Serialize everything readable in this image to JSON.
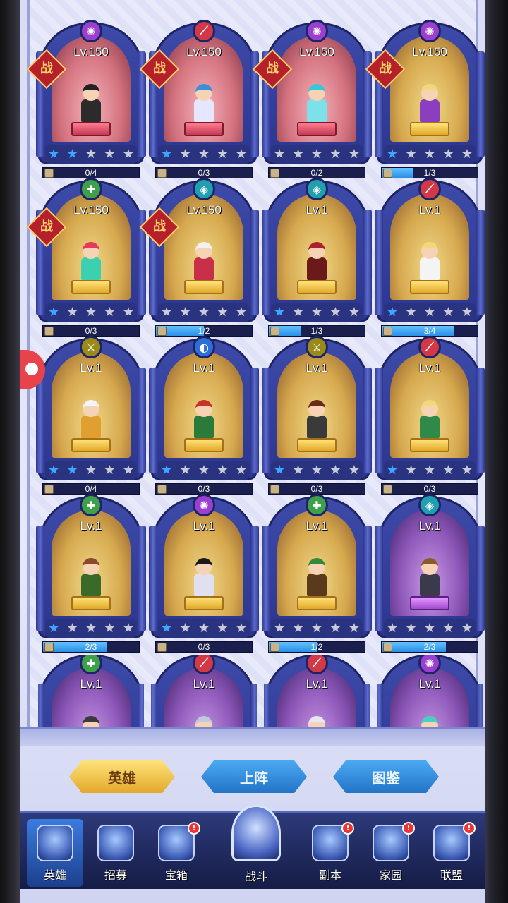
{
  "heroes": [
    {
      "class_color": "#9b3fd0",
      "class_glyph": "✺",
      "level": "Lv.150",
      "battle": "战",
      "bg": "pink",
      "hair": "#222",
      "cloth": "#2b2b2b",
      "stars_on": 2,
      "shards": "0/4",
      "fill": 0
    },
    {
      "class_color": "#d23846",
      "class_glyph": "⟋",
      "level": "Lv.150",
      "battle": "战",
      "bg": "pink",
      "hair": "#3a8fd8",
      "cloth": "#e6e6ff",
      "stars_on": 1,
      "shards": "0/3",
      "fill": 0
    },
    {
      "class_color": "#9b3fd0",
      "class_glyph": "✺",
      "level": "Lv.150",
      "battle": "战",
      "bg": "pink",
      "hair": "#39c6d9",
      "cloth": "#7ee0e8",
      "stars_on": 0,
      "shards": "0/2",
      "fill": 0
    },
    {
      "class_color": "#9b3fd0",
      "class_glyph": "✺",
      "level": "Lv.150",
      "battle": "战",
      "bg": "gold",
      "hair": "#f3d77a",
      "cloth": "#8a3fc0",
      "stars_on": 1,
      "shards": "1/3",
      "fill": 0.33
    },
    {
      "class_color": "#3ea04b",
      "class_glyph": "✚",
      "level": "Lv.150",
      "battle": "战",
      "bg": "gold",
      "hair": "#e23c5a",
      "cloth": "#3ad0b0",
      "stars_on": 1,
      "shards": "0/3",
      "fill": 0
    },
    {
      "class_color": "#1f9fb0",
      "class_glyph": "◈",
      "level": "Lv.150",
      "battle": "战",
      "bg": "gold",
      "hair": "#f2f2f2",
      "cloth": "#c8304a",
      "stars_on": 0,
      "shards": "1/2",
      "fill": 0.5
    },
    {
      "class_color": "#1f9fb0",
      "class_glyph": "◈",
      "level": "Lv.1",
      "battle": "",
      "bg": "gold",
      "hair": "#b0202a",
      "cloth": "#6a1a1a",
      "stars_on": 1,
      "shards": "1/3",
      "fill": 0.33
    },
    {
      "class_color": "#d23846",
      "class_glyph": "⟋",
      "level": "Lv.1",
      "battle": "",
      "bg": "gold",
      "hair": "#f3d77a",
      "cloth": "#f4f4f4",
      "stars_on": 1,
      "shards": "3/4",
      "fill": 0.75
    },
    {
      "class_color": "#9a8a1a",
      "class_glyph": "⚔",
      "level": "Lv.1",
      "battle": "",
      "bg": "gold",
      "hair": "#f4f4f4",
      "cloth": "#e0a030",
      "stars_on": 2,
      "shards": "0/4",
      "fill": 0
    },
    {
      "class_color": "#2d6fd6",
      "class_glyph": "◐",
      "level": "Lv.1",
      "battle": "",
      "bg": "gold",
      "hair": "#c8302a",
      "cloth": "#2a7a3a",
      "stars_on": 1,
      "shards": "0/3",
      "fill": 0
    },
    {
      "class_color": "#9a8a1a",
      "class_glyph": "⚔",
      "level": "Lv.1",
      "battle": "",
      "bg": "gold",
      "hair": "#6a2a1a",
      "cloth": "#3a3a3a",
      "stars_on": 1,
      "shards": "0/3",
      "fill": 0
    },
    {
      "class_color": "#d23846",
      "class_glyph": "⟋",
      "level": "Lv.1",
      "battle": "",
      "bg": "gold",
      "hair": "#f3d77a",
      "cloth": "#2f8a4a",
      "stars_on": 1,
      "shards": "0/3",
      "fill": 0
    },
    {
      "class_color": "#3ea04b",
      "class_glyph": "✚",
      "level": "Lv.1",
      "battle": "",
      "bg": "gold",
      "hair": "#8a4a2a",
      "cloth": "#3a6a2a",
      "stars_on": 1,
      "shards": "2/3",
      "fill": 0.67
    },
    {
      "class_color": "#9b3fd0",
      "class_glyph": "✺",
      "level": "Lv.1",
      "battle": "",
      "bg": "gold",
      "hair": "#1a1a1a",
      "cloth": "#e0e0f0",
      "stars_on": 1,
      "shards": "0/3",
      "fill": 0
    },
    {
      "class_color": "#3ea04b",
      "class_glyph": "✚",
      "level": "Lv.1",
      "battle": "",
      "bg": "gold",
      "hair": "#2f8a3a",
      "cloth": "#5a3a1a",
      "stars_on": 0,
      "shards": "1/2",
      "fill": 0.5
    },
    {
      "class_color": "#1f9fb0",
      "class_glyph": "◈",
      "level": "Lv.1",
      "battle": "",
      "bg": "purple",
      "hair": "#8a5a2a",
      "cloth": "#3a3a4a",
      "stars_on": 0,
      "shards": "2/3",
      "fill": 0.67
    },
    {
      "class_color": "#3ea04b",
      "class_glyph": "✚",
      "level": "Lv.1",
      "battle": "",
      "bg": "purple",
      "hair": "#3a3a3a",
      "cloth": "#6a6a7a",
      "stars_on": 0,
      "shards": "",
      "fill": 0
    },
    {
      "class_color": "#d23846",
      "class_glyph": "⟋",
      "level": "Lv.1",
      "battle": "",
      "bg": "purple",
      "hair": "#c0c8e0",
      "cloth": "#6a7ab0",
      "stars_on": 0,
      "shards": "",
      "fill": 0
    },
    {
      "class_color": "#d23846",
      "class_glyph": "⟋",
      "level": "Lv.1",
      "battle": "",
      "bg": "purple",
      "hair": "#e8e8f4",
      "cloth": "#a8b0d0",
      "stars_on": 0,
      "shards": "",
      "fill": 0
    },
    {
      "class_color": "#9b3fd0",
      "class_glyph": "✺",
      "level": "Lv.1",
      "battle": "",
      "bg": "purple",
      "hair": "#4ad0c0",
      "cloth": "#2a9a8a",
      "stars_on": 0,
      "shards": "",
      "fill": 0
    }
  ],
  "tabs": {
    "heroes": "英雄",
    "lineup": "上阵",
    "codex": "图鉴"
  },
  "nav": [
    {
      "label": "英雄",
      "badge": ""
    },
    {
      "label": "招募",
      "badge": ""
    },
    {
      "label": "宝箱",
      "badge": "!"
    },
    {
      "label": "战斗",
      "badge": ""
    },
    {
      "label": "副本",
      "badge": "!"
    },
    {
      "label": "家园",
      "badge": "!"
    },
    {
      "label": "联盟",
      "badge": "!"
    }
  ]
}
